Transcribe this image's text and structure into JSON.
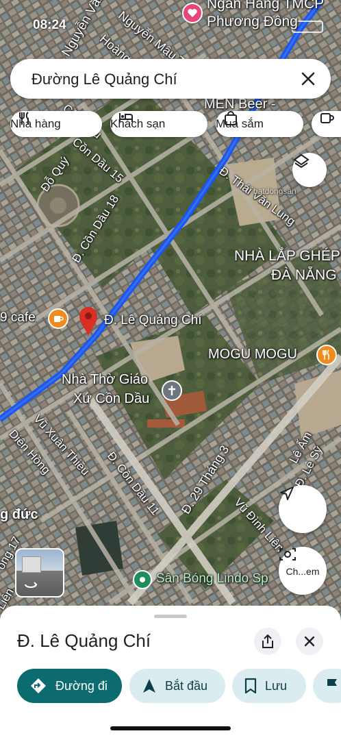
{
  "status_bar": {
    "time": "08:24"
  },
  "search": {
    "query": "Đường Lê Quảng Chí"
  },
  "chips": [
    {
      "label": "Nhà hàng",
      "icon": "fork-knife-icon"
    },
    {
      "label": "Khách sạn",
      "icon": "bed-icon"
    },
    {
      "label": "Mua sắm",
      "icon": "shopping-bag-icon"
    }
  ],
  "map_labels": {
    "nguyen_van": "Nguyễn Văn",
    "nguyen_mau_tai": "Nguyễn Mậu Tài",
    "hoang_the": "Hoàng Thế",
    "bank": "Ngân Hàng TMCP",
    "bank2": "Phương Đông",
    "men_beer": "MEN Beer -",
    "con_dau": "Cồn Dầu",
    "d_con_dau_15": "Cồn Dầu 15",
    "do_quy": "Đỗ Quý",
    "d_con_dau_18": "Đ. Cồn Dầu 18",
    "thai_van_lung": "Đ. Thái Văn Lung",
    "nha_lap_ghep": "NHÀ LẮP GHÉP",
    "da_nang": "ĐÀ NẴNG",
    "cafe": "9 cafe",
    "pin_label": "Đ. Lê Quảng Chí",
    "mogu": "MOGU MOGU",
    "church1": "Nhà Thờ Giáo",
    "church2": "Xứ Cồn Dầu",
    "vu_xuan_thieu": "Vũ Xuân Thiều",
    "dien_hong": "Diên Hồng",
    "d_con_dau_11": "Đ. Cồn Dầu 11",
    "d_29_thang_3": "Đ. 29 Tháng 3",
    "le_am": "Lê Ấm",
    "d_le_sy": "Đ. Lê Sỹ",
    "vu_dinh_lien": "Vũ Đình Liên",
    "dung_duc": "g đức",
    "cong_17": "ồng 17",
    "lien": "Liên",
    "san_bong": "Sân Bóng Lindo Sp",
    "watermark": "batdongsan"
  },
  "controls": {
    "camera_label": "Ch...em"
  },
  "place": {
    "title": "Đ. Lê Quảng Chí",
    "actions": [
      {
        "label": "Đường đi",
        "icon": "directions-icon"
      },
      {
        "label": "Bắt đầu",
        "icon": "navigation-icon"
      },
      {
        "label": "Lưu",
        "icon": "bookmark-icon"
      }
    ]
  },
  "colors": {
    "route": "#1a57f0",
    "pin": "#d93025",
    "primary": "#0b6b6e",
    "secondary": "#dbecf0",
    "poi": "#f28b1f",
    "park_pin": "#1e8e5a"
  }
}
